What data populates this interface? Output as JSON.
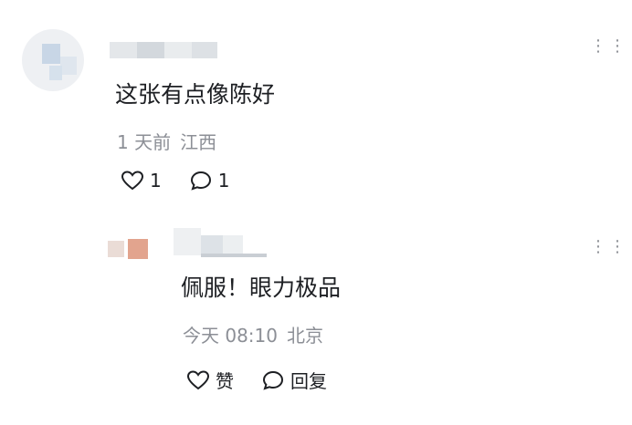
{
  "comments": [
    {
      "text": "这张有点像陈好",
      "time": "1 天前",
      "location": "江西",
      "like_count": "1",
      "reply_count": "1"
    },
    {
      "text": "佩服！眼力极品",
      "time": "今天 08:10",
      "location": "北京",
      "like_label": "赞",
      "reply_label": "回复"
    }
  ],
  "menu_icon": "more-dots-icon"
}
